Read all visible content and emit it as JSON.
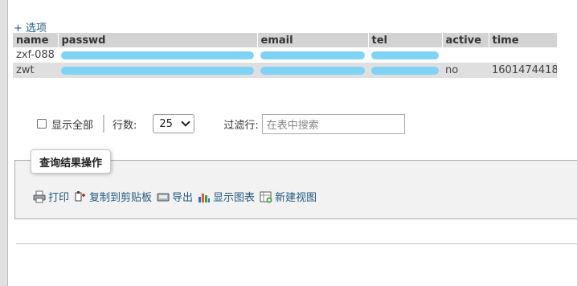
{
  "options_link": "+ 选项",
  "columns": [
    "name",
    "passwd",
    "email",
    "tel",
    "active",
    "time"
  ],
  "rows": [
    {
      "name": "zxf-088",
      "active": "",
      "time": ""
    },
    {
      "name": "zwt",
      "active": "no",
      "time": "1601474418"
    }
  ],
  "redact_color": "#7fd3f5",
  "nav": {
    "show_all_label": "显示全部",
    "rows_label": "行数:",
    "rows_value": "25",
    "filter_label": "过滤行:",
    "filter_placeholder": "在表中搜索"
  },
  "query_ops": {
    "title": "查询结果操作",
    "items": [
      {
        "label": "打印",
        "icon": "print-icon"
      },
      {
        "label": "复制到剪贴板",
        "icon": "clipboard-icon"
      },
      {
        "label": "导出",
        "icon": "export-icon"
      },
      {
        "label": "显示图表",
        "icon": "chart-icon"
      },
      {
        "label": "新建视图",
        "icon": "view-add-icon"
      }
    ]
  },
  "link_color": "#235a81"
}
